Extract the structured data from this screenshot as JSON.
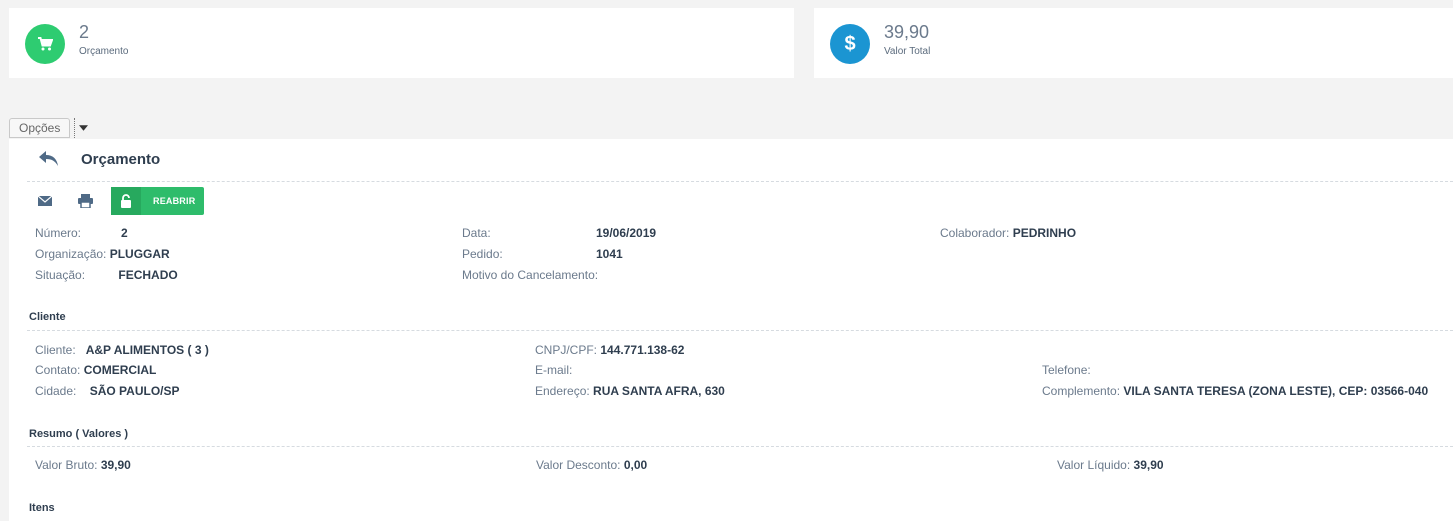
{
  "cards": [
    {
      "value": "2",
      "label": "Orçamento",
      "icon": "cart-icon",
      "color": "#2ecc71"
    },
    {
      "value": "39,90",
      "label": "Valor Total",
      "icon": "dollar-icon",
      "color": "#1b95d2"
    }
  ],
  "options": {
    "label": "Opções"
  },
  "page": {
    "title": "Orçamento"
  },
  "toolbar": {
    "reopen_label": "REABRIR"
  },
  "header_fields": {
    "numero": {
      "label": "Número:",
      "value": "2"
    },
    "organizacao": {
      "label": "Organização:",
      "value": "PLUGGAR"
    },
    "situacao": {
      "label": "Situação:",
      "value": "FECHADO"
    },
    "data": {
      "label": "Data:",
      "value": "19/06/2019"
    },
    "pedido": {
      "label": "Pedido:",
      "value": "1041"
    },
    "motivo": {
      "label": "Motivo do Cancelamento:",
      "value": ""
    },
    "colaborador": {
      "label": "Colaborador:",
      "value": "PEDRINHO"
    }
  },
  "cliente": {
    "section_title": "Cliente",
    "cliente": {
      "label": "Cliente:",
      "value": "A&P ALIMENTOS ( 3 )"
    },
    "contato": {
      "label": "Contato:",
      "value": "COMERCIAL"
    },
    "cidade": {
      "label": "Cidade:",
      "value": "SÃO PAULO/SP"
    },
    "cnpj": {
      "label": "CNPJ/CPF:",
      "value": "144.771.138-62"
    },
    "email": {
      "label": "E-mail:",
      "value": ""
    },
    "endereco": {
      "label": "Endereço:",
      "value": "RUA SANTA AFRA, 630"
    },
    "telefone": {
      "label": "Telefone:",
      "value": ""
    },
    "complemento": {
      "label": "Complemento:",
      "value": "VILA SANTA TERESA (ZONA LESTE), CEP: 03566-040"
    }
  },
  "resumo": {
    "section_title": "Resumo ( Valores )",
    "bruto": {
      "label": "Valor Bruto:",
      "value": "39,90"
    },
    "desconto": {
      "label": "Valor Desconto:",
      "value": "0,00"
    },
    "liquido": {
      "label": "Valor Líquido:",
      "value": "39,90"
    }
  },
  "itens": {
    "section_title": "Itens"
  }
}
